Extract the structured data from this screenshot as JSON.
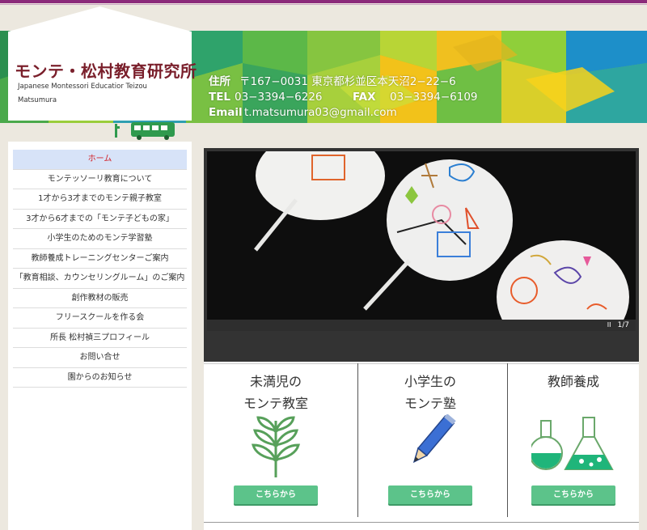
{
  "header": {
    "logo_title": "モンテ・松村教育研究所",
    "logo_subtitle": "Japanese Montessori Educatior Teizou Matsumura",
    "address_label": "住所",
    "address_value": "〒167−0031 東京都杉並区本天沼2−22−6",
    "tel_label": "TEL",
    "tel_value": "03−3394−6226",
    "fax_label": "FAX",
    "fax_value": "03−3394−6109",
    "email_label": "Email",
    "email_value": "t.matsumura03@gmail.com"
  },
  "sidebar": {
    "items": [
      {
        "label": "ホーム"
      },
      {
        "label": "モンテッソーリ教育について"
      },
      {
        "label": "1才から3才までのモンテ親子教室"
      },
      {
        "label": "3才から6才までの「モンテ子どもの家」"
      },
      {
        "label": "小学生のためのモンテ学習塾"
      },
      {
        "label": "教師養成トレーニングセンターご案内"
      },
      {
        "label": "「教育相談、カウンセリングルーム」のご案内"
      },
      {
        "label": "創作教材の販売"
      },
      {
        "label": "フリースクールを作る会"
      },
      {
        "label": "所長 松村禎三プロフィール"
      },
      {
        "label": "お問い合せ"
      },
      {
        "label": "園からのお知らせ"
      }
    ]
  },
  "slider": {
    "pager": "1/7",
    "pause_glyph": "II"
  },
  "features": [
    {
      "title_line1": "未満児の",
      "title_line2": "モンテ教室",
      "button": "こちらから",
      "icon": "leaf-icon"
    },
    {
      "title_line1": "小学生の",
      "title_line2": "モンテ塾",
      "button": "こちらから",
      "icon": "pencil-icon"
    },
    {
      "title_line1": "教師養成",
      "title_line2": "",
      "button": "こちらから",
      "icon": "flask-icon"
    }
  ],
  "colors": {
    "accent": "#8b2a7a",
    "logo_title": "#7a1f2b",
    "button": "#5cc38a",
    "active_nav_bg": "#d7e3f8",
    "active_nav_text": "#d2232a"
  }
}
